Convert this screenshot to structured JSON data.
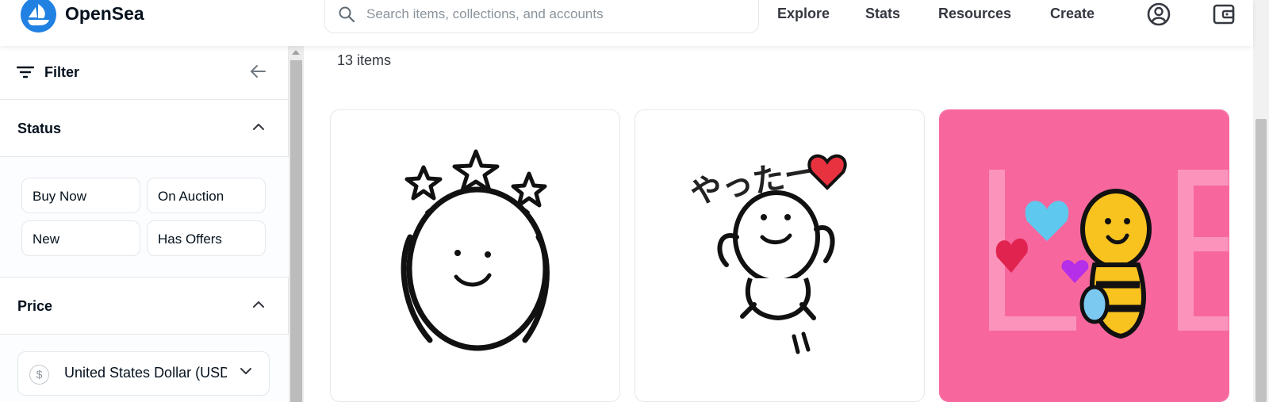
{
  "header": {
    "brand": "OpenSea",
    "search_placeholder": "Search items, collections, and accounts",
    "nav": [
      "Explore",
      "Stats",
      "Resources",
      "Create"
    ],
    "icons": [
      "account-icon",
      "wallet-icon"
    ]
  },
  "sidebar": {
    "filter_label": "Filter",
    "status": {
      "title": "Status",
      "options": [
        "Buy Now",
        "On Auction",
        "New",
        "Has Offers"
      ]
    },
    "price": {
      "title": "Price",
      "currency": "United States Dollar (USD)",
      "currency_symbol": "$"
    }
  },
  "main": {
    "item_count": "13 items",
    "cards": [
      {
        "art": "smiling-blob-with-star-crown"
      },
      {
        "art": "cheering-blob-with-heart",
        "art_text": "やったー"
      },
      {
        "art": "yellow-bee-with-hearts",
        "background": "#f7679e"
      }
    ]
  },
  "colors": {
    "accent": "#2081e2",
    "text": "#04111d",
    "border": "#e5e8eb",
    "card3_bg": "#f7679e"
  }
}
